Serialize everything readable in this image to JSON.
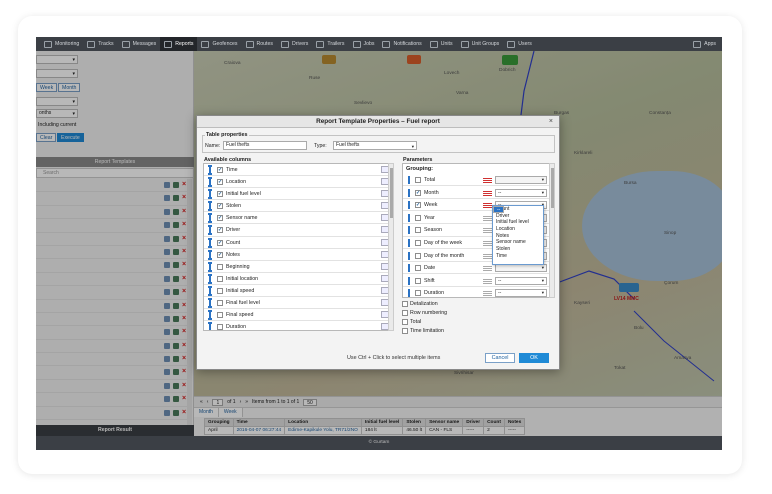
{
  "nav": {
    "tabs": [
      {
        "label": "Monitoring"
      },
      {
        "label": "Tracks"
      },
      {
        "label": "Messages"
      },
      {
        "label": "Reports"
      },
      {
        "label": "Geofences"
      },
      {
        "label": "Routes"
      },
      {
        "label": "Drivers"
      },
      {
        "label": "Trailers"
      },
      {
        "label": "Jobs"
      },
      {
        "label": "Notifications"
      },
      {
        "label": "Units"
      },
      {
        "label": "Unit Groups"
      },
      {
        "label": "Users"
      }
    ],
    "right_label": "Apps"
  },
  "left": {
    "week_label": "Week",
    "month_label": "Month",
    "months_value": "onths",
    "including_current_label": "Including current",
    "clear_label": "Clear",
    "execute_label": "Execute",
    "templates_header": "Report Templates",
    "search_placeholder": "Search",
    "result_header": "Report Result"
  },
  "map": {
    "labels": [
      "Craiova",
      "Ruse",
      "Varna",
      "Sofia",
      "Burgas",
      "Plovdiv",
      "Istanbul",
      "Samsun",
      "Ankara",
      "Alexandria",
      "Sevlievo",
      "Lovech",
      "Dobrich",
      "Constanța",
      "Kirklareli",
      "Bursa",
      "Izmir",
      "Konya",
      "Kayseri",
      "Bolu",
      "Zonguldak",
      "Kastamonu",
      "Düzce",
      "Sinop",
      "Çorum",
      "Yozgat",
      "Eskişehir",
      "Kütahya",
      "Balıkesir",
      "Manisa",
      "Afyonkarahisar",
      "Usak",
      "Sivrihisar",
      "Tokat",
      "Amasya"
    ],
    "vehicle_label": "LV14 MMC"
  },
  "dialog": {
    "title": "Report Template Properties – Fuel report",
    "table_properties_legend": "Table properties",
    "name_label": "Name:",
    "name_value": "Fuel thefts",
    "type_label": "Type:",
    "type_value": "Fuel thefts",
    "available_columns_legend": "Available columns",
    "columns": [
      {
        "label": "Time",
        "checked": true
      },
      {
        "label": "Location",
        "checked": true
      },
      {
        "label": "Initial fuel level",
        "checked": true
      },
      {
        "label": "Stolen",
        "checked": true
      },
      {
        "label": "Sensor name",
        "checked": true
      },
      {
        "label": "Driver",
        "checked": true
      },
      {
        "label": "Count",
        "checked": true
      },
      {
        "label": "Notes",
        "checked": true
      },
      {
        "label": "Beginning",
        "checked": false
      },
      {
        "label": "Initial location",
        "checked": false
      },
      {
        "label": "Initial speed",
        "checked": false
      },
      {
        "label": "Final fuel level",
        "checked": false
      },
      {
        "label": "Final speed",
        "checked": false
      },
      {
        "label": "Duration",
        "checked": false
      }
    ],
    "parameters_legend": "Parameters",
    "grouping_label": "Grouping:",
    "grouping_rows": [
      {
        "label": "Total",
        "checked": false,
        "select": "",
        "ind": "red"
      },
      {
        "label": "Month",
        "checked": true,
        "select": "--",
        "ind": "red"
      },
      {
        "label": "Week",
        "checked": true,
        "select": "--",
        "ind": "red"
      },
      {
        "label": "Year",
        "checked": false,
        "select": "",
        "ind": "grey"
      },
      {
        "label": "Season",
        "checked": false,
        "select": "",
        "ind": "grey"
      },
      {
        "label": "Day of the week",
        "checked": false,
        "select": "",
        "ind": "grey"
      },
      {
        "label": "Day of the month",
        "checked": false,
        "select": "",
        "ind": "grey"
      },
      {
        "label": "Date",
        "checked": false,
        "select": "",
        "ind": "grey"
      },
      {
        "label": "Shift",
        "checked": false,
        "select": "--",
        "ind": "grey"
      },
      {
        "label": "Duration",
        "checked": false,
        "select": "--",
        "ind": "grey"
      }
    ],
    "dropdown_options": [
      "--",
      "Count",
      "Driver",
      "Initial fuel level",
      "Location",
      "Notes",
      "Sensor name",
      "Stolen",
      "Time"
    ],
    "options": [
      {
        "label": "Detalization"
      },
      {
        "label": "Row numbering"
      },
      {
        "label": "Total"
      },
      {
        "label": "Time limitation"
      }
    ],
    "hint": "Use Ctrl + Click to select multiple items",
    "cancel_label": "Cancel",
    "ok_label": "OK"
  },
  "results": {
    "page_value": "1",
    "page_of": "of 1",
    "items_text": "Items from 1 to 1 of 1",
    "per_page": "50",
    "tabs": [
      "Month",
      "Week"
    ],
    "headers": [
      "Grouping",
      "Time",
      "Location",
      "Initial fuel level",
      "Stolen",
      "Sensor name",
      "Driver",
      "Count",
      "Notes"
    ],
    "rows": [
      [
        "April",
        "2016-04-07 06:27:44",
        "Edirne-Kapikule Yolu, TR71/2NO",
        "184 lt",
        "46.50 lt",
        "CAN - FLS",
        "-----",
        "2",
        "-----"
      ]
    ]
  },
  "status": "© Gurtam",
  "colors": {
    "accent": "#1f8ad6",
    "nav_bg": "#3b3f45",
    "delete": "#d41b1b"
  }
}
